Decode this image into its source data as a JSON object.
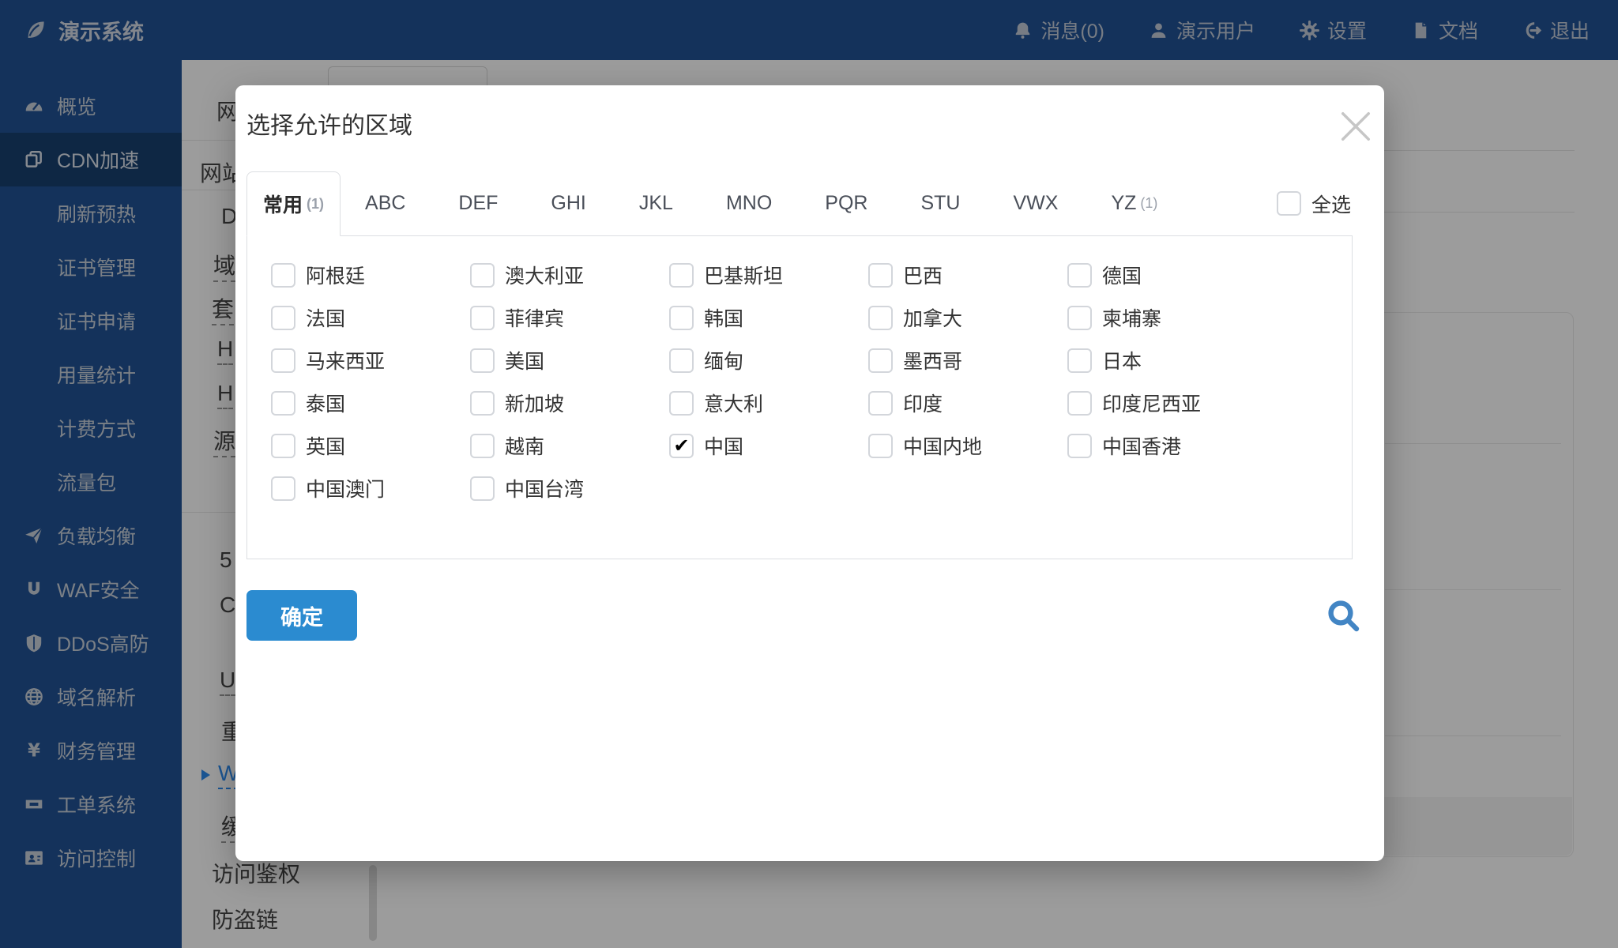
{
  "colors": {
    "navy": "#215295",
    "accent_blue": "#2d8cf0",
    "confirm_blue": "#2b8bd0",
    "search_blue": "#4285c4"
  },
  "icons": {
    "brand": "leaf-icon",
    "notifications": "bell-icon",
    "user": "user-icon",
    "settings": "gear-icon",
    "docs": "document-icon",
    "exit": "logout-icon",
    "close": "close-icon",
    "search": "search-icon",
    "checked_mark": "check-icon"
  },
  "topbar": {
    "brand": "演示系统",
    "items": [
      {
        "label": "消息(0)",
        "icon": "bell-icon",
        "icon_ref": "#i-bell"
      },
      {
        "label": "演示用户",
        "icon": "user-icon",
        "icon_ref": "#i-user"
      },
      {
        "label": "设置",
        "icon": "gear-icon",
        "icon_ref": "#i-gear"
      },
      {
        "label": "文档",
        "icon": "document-icon",
        "icon_ref": "#i-doc"
      },
      {
        "label": "退出",
        "icon": "logout-icon",
        "icon_ref": "#i-logout"
      }
    ]
  },
  "sidebar": {
    "items": [
      {
        "label": "概览",
        "icon": "gauge-icon",
        "icon_ref": "#i-gauge"
      },
      {
        "label": "CDN加速",
        "icon": "copy-icon",
        "icon_ref": "#i-copy",
        "active": true
      },
      {
        "label": "刷新预热",
        "sub": true
      },
      {
        "label": "证书管理",
        "sub": true
      },
      {
        "label": "证书申请",
        "sub": true
      },
      {
        "label": "用量统计",
        "sub": true
      },
      {
        "label": "计费方式",
        "sub": true
      },
      {
        "label": "流量包",
        "sub": true
      },
      {
        "label": "负载均衡",
        "icon": "plane-icon",
        "icon_ref": "#i-plane"
      },
      {
        "label": "WAF安全",
        "icon": "magnet-icon",
        "icon_ref": "#i-waf"
      },
      {
        "label": "DDoS高防",
        "icon": "shield-icon",
        "icon_ref": "#i-shield"
      },
      {
        "label": "域名解析",
        "icon": "globe-icon",
        "icon_ref": "#i-globe"
      },
      {
        "label": "财务管理",
        "icon": "yen-icon",
        "icon_ref": "#i-yen"
      },
      {
        "label": "工单系统",
        "icon": "ticket-icon",
        "icon_ref": "#i-ticket"
      },
      {
        "label": "访问控制",
        "icon": "idcard-icon",
        "icon_ref": "#i-idcard"
      }
    ]
  },
  "background": {
    "fragments": [
      {
        "text": "网"
      },
      {
        "text": "网站"
      },
      {
        "text": "D"
      },
      {
        "text": "域",
        "dashed": true
      },
      {
        "text": "套",
        "dashed": true
      },
      {
        "text": "H",
        "dashed": true
      },
      {
        "text": "H",
        "dashed": true
      },
      {
        "text": "源",
        "dashed": true
      },
      {
        "text": "5"
      },
      {
        "text": "C"
      },
      {
        "text": "U",
        "dashed": true
      },
      {
        "text": "重"
      },
      {
        "text": "W",
        "dashed": true,
        "link": true
      },
      {
        "text": "缓",
        "dashed": true
      },
      {
        "text": "访问鉴权"
      },
      {
        "text": "防盗链"
      }
    ]
  },
  "modal": {
    "title": "选择允许的区域",
    "check_glyph": "✔",
    "select_all_label": "全选",
    "confirm_label": "确定",
    "tabs": [
      {
        "label": "常用",
        "count_label": "(1)",
        "active": true
      },
      {
        "label": "ABC"
      },
      {
        "label": "DEF"
      },
      {
        "label": "GHI"
      },
      {
        "label": "JKL"
      },
      {
        "label": "MNO"
      },
      {
        "label": "PQR"
      },
      {
        "label": "STU"
      },
      {
        "label": "VWX"
      },
      {
        "label": "YZ",
        "count_label": "(1)"
      }
    ],
    "regions": [
      {
        "label": "阿根廷"
      },
      {
        "label": "澳大利亚"
      },
      {
        "label": "巴基斯坦"
      },
      {
        "label": "巴西"
      },
      {
        "label": "德国"
      },
      {
        "label": "法国"
      },
      {
        "label": "菲律宾"
      },
      {
        "label": "韩国"
      },
      {
        "label": "加拿大"
      },
      {
        "label": "柬埔寨"
      },
      {
        "label": "马来西亚"
      },
      {
        "label": "美国"
      },
      {
        "label": "缅甸"
      },
      {
        "label": "墨西哥"
      },
      {
        "label": "日本"
      },
      {
        "label": "泰国"
      },
      {
        "label": "新加坡"
      },
      {
        "label": "意大利"
      },
      {
        "label": "印度"
      },
      {
        "label": "印度尼西亚"
      },
      {
        "label": "英国"
      },
      {
        "label": "越南"
      },
      {
        "label": "中国",
        "checked": true
      },
      {
        "label": "中国内地"
      },
      {
        "label": "中国香港"
      },
      {
        "label": "中国澳门"
      },
      {
        "label": "中国台湾"
      }
    ]
  }
}
